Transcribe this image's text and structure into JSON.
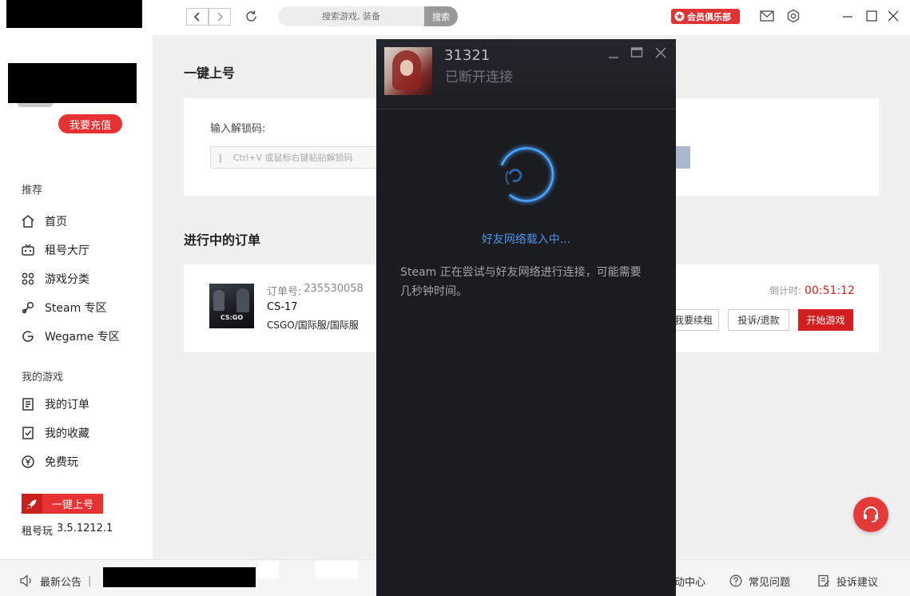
{
  "topbar": {
    "search_placeholder": "搜索游戏, 装备",
    "search_button": "搜索",
    "vip_label": "会员俱乐部"
  },
  "sidebar": {
    "recharge_button": "我要充值",
    "section_recommend": "推荐",
    "recommend_items": [
      {
        "label": "首页",
        "icon": "home-icon"
      },
      {
        "label": "租号大厅",
        "icon": "gamepad-icon"
      },
      {
        "label": "游戏分类",
        "icon": "grid-icon"
      },
      {
        "label": "Steam 专区",
        "icon": "steam-icon"
      },
      {
        "label": "Wegame 专区",
        "icon": "wegame-icon"
      }
    ],
    "section_mygames": "我的游戏",
    "mygame_items": [
      {
        "label": "我的订单",
        "icon": "order-icon"
      },
      {
        "label": "我的收藏",
        "icon": "favorite-icon"
      },
      {
        "label": "免费玩",
        "icon": "yen-icon"
      }
    ],
    "quick_login_button": "一键上号",
    "app_name": "租号玩",
    "version": "3.5.1212.1"
  },
  "main": {
    "quick_title": "一键上号",
    "unlock_label": "输入解锁码:",
    "unlock_placeholder": "Ctrl+V 或鼠标右键粘贴解锁码",
    "orders_title": "进行中的订单",
    "order": {
      "order_no_label": "订单号:",
      "order_no": "235530058",
      "name": "CS-17",
      "region": "CSGO/国际服/国际服",
      "thumb_text": "CS:GO",
      "countdown_label": "倒计时:",
      "countdown": "00:51:12",
      "renew_button": "我要续租",
      "complaint_button": "投诉/退款",
      "start_button": "开始游戏"
    }
  },
  "bottombar": {
    "notice": "最新公告",
    "activity": "动中心",
    "faq": "常见问题",
    "feedback": "投诉建议"
  },
  "steam": {
    "username": "31321",
    "status": "已断开连接",
    "loading_text": "好友网络载入中...",
    "message": "Steam 正在尝试与好友网络进行连接，可能需要几秒钟时间。"
  },
  "colors": {
    "brand_red": "#e63232",
    "countdown_red": "#d21e1e",
    "steam_bg": "#1b1c20",
    "steam_blue": "#3a8fe0"
  }
}
